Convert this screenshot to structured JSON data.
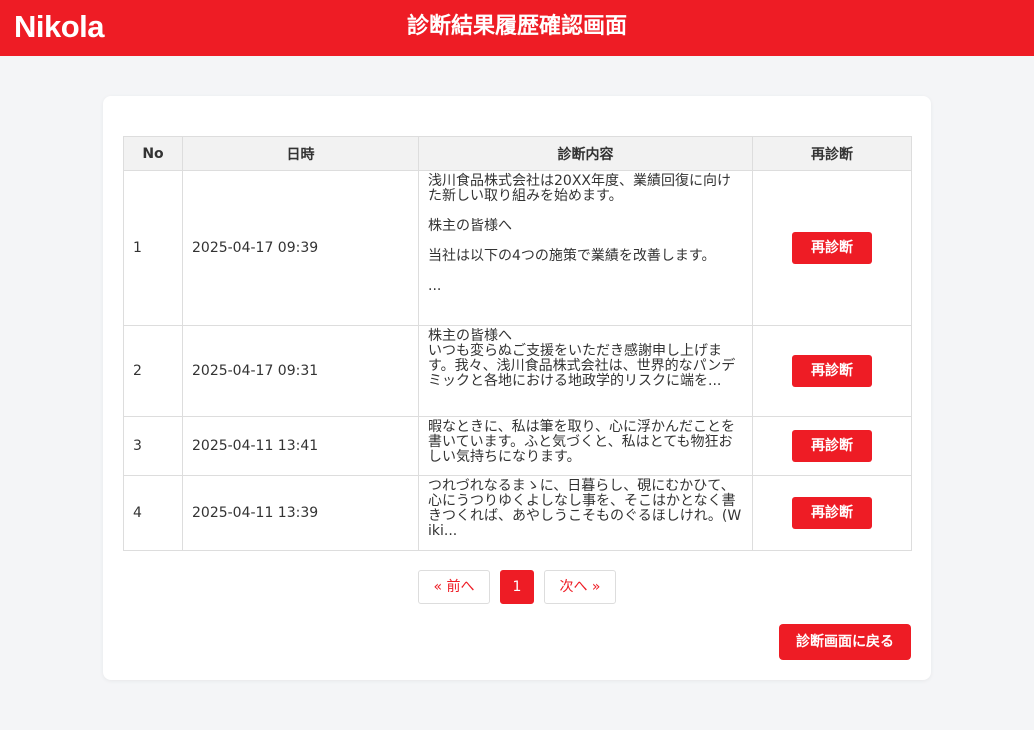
{
  "header": {
    "logo": "Nikola",
    "title": "診断結果履歴確認画面"
  },
  "table": {
    "columns": [
      "No",
      "日時",
      "診断内容",
      "再診断"
    ],
    "rows": [
      {
        "no": "1",
        "datetime": "2025-04-17 09:39",
        "content": "浅川食品株式会社は20XX年度、業績回復に向けた新しい取り組みを始めます。\n\n株主の皆様へ\n\n当社は以下の4つの施策で業績を改善します。\n\n...",
        "action": "再診断"
      },
      {
        "no": "2",
        "datetime": "2025-04-17 09:31",
        "content": "株主の皆様へ\nいつも変らぬご支援をいただき感謝申し上げます。我々、浅川食品株式会社は、世界的なパンデミックと各地における地政学的リスクに端を...",
        "action": "再診断"
      },
      {
        "no": "3",
        "datetime": "2025-04-11 13:41",
        "content": "暇なときに、私は筆を取り、心に浮かんだことを書いています。ふと気づくと、私はとても物狂おしい気持ちになります。",
        "action": "再診断"
      },
      {
        "no": "4",
        "datetime": "2025-04-11 13:39",
        "content": "つれづれなるまゝに、日暮らし、硯にむかひて、心にうつりゆくよしなし事を、そこはかとなく書きつくれば、あやしうこそものぐるほしけれ。(Wiki...",
        "action": "再診断"
      }
    ]
  },
  "pagination": {
    "prev": "« 前へ",
    "current": "1",
    "next": "次へ »"
  },
  "back_button": "診断画面に戻る",
  "colors": {
    "accent": "#ee1c25",
    "background": "#f4f5f7"
  }
}
